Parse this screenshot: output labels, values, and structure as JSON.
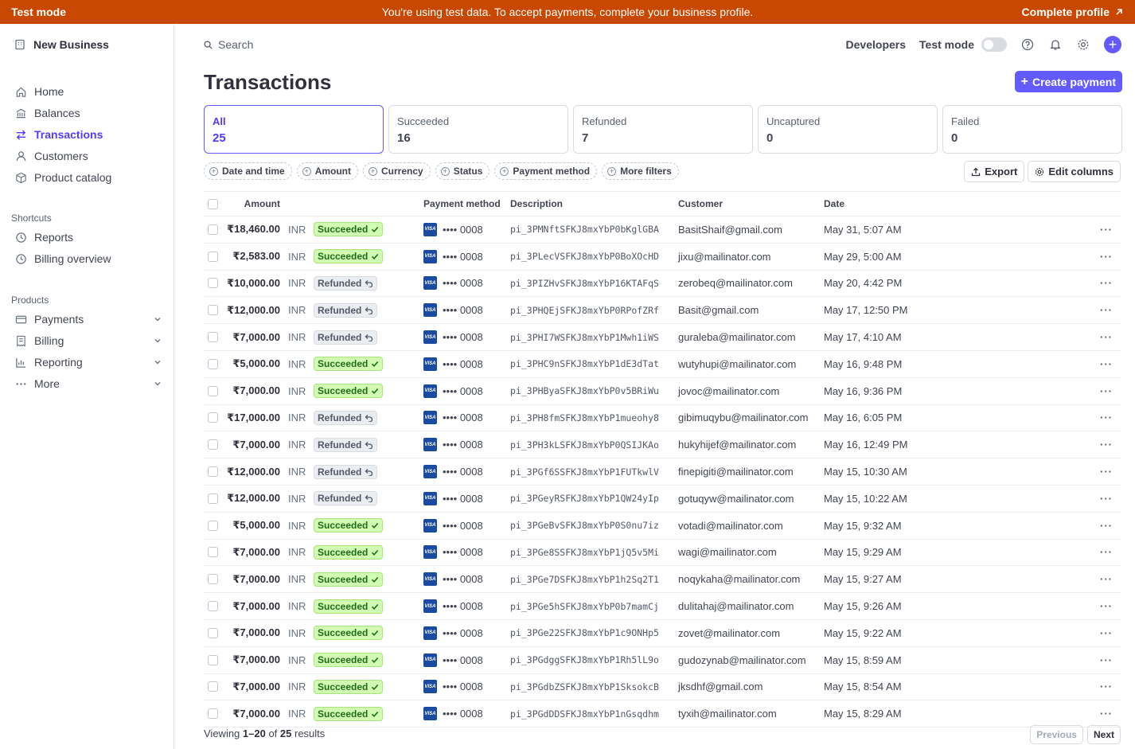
{
  "banner": {
    "left": "Test mode",
    "center": "You're using test data. To accept payments, complete your business profile.",
    "right": "Complete profile"
  },
  "sidebar": {
    "business": "New Business",
    "items": [
      {
        "label": "Home",
        "icon": "home-icon"
      },
      {
        "label": "Balances",
        "icon": "balances-icon"
      },
      {
        "label": "Transactions",
        "icon": "transactions-icon",
        "active": true
      },
      {
        "label": "Customers",
        "icon": "customers-icon"
      },
      {
        "label": "Product catalog",
        "icon": "product-catalog-icon"
      }
    ],
    "shortcuts_label": "Shortcuts",
    "shortcuts": [
      {
        "label": "Reports",
        "icon": "clock-icon"
      },
      {
        "label": "Billing overview",
        "icon": "clock-icon"
      }
    ],
    "products_label": "Products",
    "products": [
      {
        "label": "Payments",
        "icon": "payments-icon"
      },
      {
        "label": "Billing",
        "icon": "billing-icon"
      },
      {
        "label": "Reporting",
        "icon": "reporting-icon"
      },
      {
        "label": "More",
        "icon": "more-dots-icon"
      }
    ]
  },
  "topbar": {
    "search_placeholder": "Search",
    "developers": "Developers",
    "test_mode": "Test mode"
  },
  "page": {
    "title": "Transactions",
    "create_button": "Create payment"
  },
  "tabs": [
    {
      "label": "All",
      "count": "25"
    },
    {
      "label": "Succeeded",
      "count": "16"
    },
    {
      "label": "Refunded",
      "count": "7"
    },
    {
      "label": "Uncaptured",
      "count": "0"
    },
    {
      "label": "Failed",
      "count": "0"
    }
  ],
  "filters": [
    "Date and time",
    "Amount",
    "Currency",
    "Status",
    "Payment method",
    "More filters"
  ],
  "actions": {
    "export": "Export",
    "edit_columns": "Edit columns"
  },
  "table": {
    "columns": {
      "amount": "Amount",
      "payment_method": "Payment method",
      "description": "Description",
      "customer": "Customer",
      "date": "Date"
    },
    "rows": [
      {
        "amount": "₹18,460.00",
        "currency": "INR",
        "status": "Succeeded",
        "card": "•••• 0008",
        "desc": "pi_3PMNftSFKJ8mxYbP0bKglGBA",
        "customer": "BasitShaif@gmail.com",
        "date": "May 31, 5:07 AM"
      },
      {
        "amount": "₹2,583.00",
        "currency": "INR",
        "status": "Succeeded",
        "card": "•••• 0008",
        "desc": "pi_3PLecVSFKJ8mxYbP0BoXOcHD",
        "customer": "jixu@mailinator.com",
        "date": "May 29, 5:00 AM"
      },
      {
        "amount": "₹10,000.00",
        "currency": "INR",
        "status": "Refunded",
        "card": "•••• 0008",
        "desc": "pi_3PIZHvSFKJ8mxYbP16KTAFqS",
        "customer": "zerobeq@mailinator.com",
        "date": "May 20, 4:42 PM"
      },
      {
        "amount": "₹12,000.00",
        "currency": "INR",
        "status": "Refunded",
        "card": "•••• 0008",
        "desc": "pi_3PHQEjSFKJ8mxYbP0RPofZRf",
        "customer": "Basit@gmail.com",
        "date": "May 17, 12:50 PM"
      },
      {
        "amount": "₹7,000.00",
        "currency": "INR",
        "status": "Refunded",
        "card": "•••• 0008",
        "desc": "pi_3PHI7WSFKJ8mxYbP1Mwh1iWS",
        "customer": "guraleba@mailinator.com",
        "date": "May 17, 4:10 AM"
      },
      {
        "amount": "₹5,000.00",
        "currency": "INR",
        "status": "Succeeded",
        "card": "•••• 0008",
        "desc": "pi_3PHC9nSFKJ8mxYbP1dE3dTat",
        "customer": "wutyhupi@mailinator.com",
        "date": "May 16, 9:48 PM"
      },
      {
        "amount": "₹7,000.00",
        "currency": "INR",
        "status": "Succeeded",
        "card": "•••• 0008",
        "desc": "pi_3PHByaSFKJ8mxYbP0v5BRiWu",
        "customer": "jovoc@mailinator.com",
        "date": "May 16, 9:36 PM"
      },
      {
        "amount": "₹17,000.00",
        "currency": "INR",
        "status": "Refunded",
        "card": "•••• 0008",
        "desc": "pi_3PH8fmSFKJ8mxYbP1mueohy8",
        "customer": "gibimuqybu@mailinator.com",
        "date": "May 16, 6:05 PM"
      },
      {
        "amount": "₹7,000.00",
        "currency": "INR",
        "status": "Refunded",
        "card": "•••• 0008",
        "desc": "pi_3PH3kLSFKJ8mxYbP0QSIJKAo",
        "customer": "hukyhijef@mailinator.com",
        "date": "May 16, 12:49 PM"
      },
      {
        "amount": "₹12,000.00",
        "currency": "INR",
        "status": "Refunded",
        "card": "•••• 0008",
        "desc": "pi_3PGf6SSFKJ8mxYbP1FUTkwlV",
        "customer": "finepigiti@mailinator.com",
        "date": "May 15, 10:30 AM"
      },
      {
        "amount": "₹12,000.00",
        "currency": "INR",
        "status": "Refunded",
        "card": "•••• 0008",
        "desc": "pi_3PGeyRSFKJ8mxYbP1QW24yIp",
        "customer": "gotuqyw@mailinator.com",
        "date": "May 15, 10:22 AM"
      },
      {
        "amount": "₹5,000.00",
        "currency": "INR",
        "status": "Succeeded",
        "card": "•••• 0008",
        "desc": "pi_3PGeBvSFKJ8mxYbP0S0nu7iz",
        "customer": "votadi@mailinator.com",
        "date": "May 15, 9:32 AM"
      },
      {
        "amount": "₹7,000.00",
        "currency": "INR",
        "status": "Succeeded",
        "card": "•••• 0008",
        "desc": "pi_3PGe8SSFKJ8mxYbP1jQ5v5Mi",
        "customer": "wagi@mailinator.com",
        "date": "May 15, 9:29 AM"
      },
      {
        "amount": "₹7,000.00",
        "currency": "INR",
        "status": "Succeeded",
        "card": "•••• 0008",
        "desc": "pi_3PGe7DSFKJ8mxYbP1h2Sq2T1",
        "customer": "noqykaha@mailinator.com",
        "date": "May 15, 9:27 AM"
      },
      {
        "amount": "₹7,000.00",
        "currency": "INR",
        "status": "Succeeded",
        "card": "•••• 0008",
        "desc": "pi_3PGe5hSFKJ8mxYbP0b7mamCj",
        "customer": "dulitahaj@mailinator.com",
        "date": "May 15, 9:26 AM"
      },
      {
        "amount": "₹7,000.00",
        "currency": "INR",
        "status": "Succeeded",
        "card": "•••• 0008",
        "desc": "pi_3PGe22SFKJ8mxYbP1c9ONHp5",
        "customer": "zovet@mailinator.com",
        "date": "May 15, 9:22 AM"
      },
      {
        "amount": "₹7,000.00",
        "currency": "INR",
        "status": "Succeeded",
        "card": "•••• 0008",
        "desc": "pi_3PGdggSFKJ8mxYbP1Rh5lL9o",
        "customer": "gudozynab@mailinator.com",
        "date": "May 15, 8:59 AM"
      },
      {
        "amount": "₹7,000.00",
        "currency": "INR",
        "status": "Succeeded",
        "card": "•••• 0008",
        "desc": "pi_3PGdbZSFKJ8mxYbP1SksokcB",
        "customer": "jksdhf@gmail.com",
        "date": "May 15, 8:54 AM"
      },
      {
        "amount": "₹7,000.00",
        "currency": "INR",
        "status": "Succeeded",
        "card": "•••• 0008",
        "desc": "pi_3PGdDDSFKJ8mxYbP1nGsqdhm",
        "customer": "tyxih@mailinator.com",
        "date": "May 15, 8:29 AM"
      }
    ]
  },
  "footer": {
    "prefix": "Viewing ",
    "range": "1–20",
    "of": " of ",
    "total": "25",
    "suffix": " results"
  },
  "pager": {
    "previous": "Previous",
    "next": "Next"
  },
  "colors": {
    "banner": "#c84801",
    "accent": "#635bff",
    "succeeded_bg": "#d1fab3",
    "refunded_bg": "#ebeef1"
  }
}
